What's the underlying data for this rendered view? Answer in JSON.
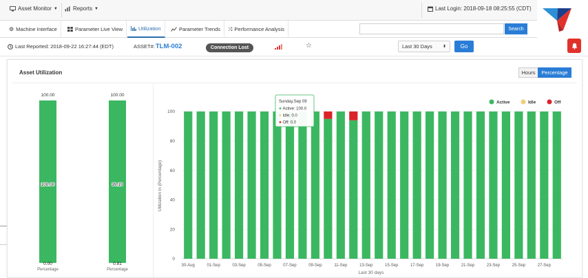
{
  "topbar": {
    "asset_monitor_label": "Asset Monitor",
    "reports_label": "Reports",
    "last_login": "Last Login: 2018-09-18 08:25:55 (CDT)"
  },
  "tabs": [
    {
      "label": "Machine Interface"
    },
    {
      "label": "Parameter Live View"
    },
    {
      "label": "Utilization"
    },
    {
      "label": "Parameter Trends"
    },
    {
      "label": "Performance Analysis"
    }
  ],
  "search": {
    "placeholder": "",
    "button_label": "Search"
  },
  "status": {
    "last_reported": "Last Reported: 2018-09-22 16:27:44 (EDT)",
    "asset_prefix": "ASSET#:",
    "asset_id": "TLM-002",
    "connection": "Connection Lost",
    "range_selected": "Last 30 Days",
    "go_label": "Go"
  },
  "panel": {
    "title": "Asset Utilization",
    "toggle_hours": "Hours",
    "toggle_percentage": "Percentage"
  },
  "colors": {
    "active": "#3cb761",
    "idle": "#f1cd7c",
    "off": "#d9242a",
    "accent": "#2a7dd6"
  },
  "summary_gauges": [
    {
      "top_value": "100.00",
      "center_value": "100.00",
      "bottom_value": "0.00",
      "axis_label": "Percentage",
      "value": 100
    },
    {
      "top_value": "100.00",
      "center_value": "99.19",
      "bottom_value": "0.81",
      "axis_label": "Percentage",
      "value": 100
    }
  ],
  "chart_data": {
    "type": "bar",
    "stacked": true,
    "xlabel": "Last 30 days",
    "ylabel": "Utilization in (Percentage)",
    "ylim": [
      0,
      100
    ],
    "yticks": [
      0,
      20,
      40,
      60,
      80,
      100
    ],
    "legend_position": "top-right",
    "x_tick_labels": [
      "30-Aug",
      "01-Sep",
      "03-Sep",
      "05-Sep",
      "07-Sep",
      "09-Sep",
      "11-Sep",
      "13-Sep",
      "15-Sep",
      "17-Sep",
      "19-Sep",
      "21-Sep",
      "23-Sep",
      "25-Sep",
      "27-Sep"
    ],
    "categories": [
      "30-Aug",
      "31-Aug",
      "01-Sep",
      "02-Sep",
      "03-Sep",
      "04-Sep",
      "05-Sep",
      "06-Sep",
      "07-Sep",
      "08-Sep",
      "09-Sep",
      "10-Sep",
      "11-Sep",
      "12-Sep",
      "13-Sep",
      "14-Sep",
      "15-Sep",
      "16-Sep",
      "17-Sep",
      "18-Sep",
      "19-Sep",
      "20-Sep",
      "21-Sep",
      "22-Sep",
      "23-Sep",
      "24-Sep",
      "25-Sep",
      "26-Sep",
      "27-Sep",
      "28-Sep"
    ],
    "series": [
      {
        "name": "Active",
        "values": [
          100,
          100,
          100,
          100,
          100,
          100,
          100,
          100,
          100,
          100,
          100,
          95,
          100,
          94,
          100,
          100,
          100,
          100,
          100,
          100,
          100,
          100,
          100,
          100,
          100,
          100,
          100,
          100,
          100,
          100
        ]
      },
      {
        "name": "Idle",
        "values": [
          0,
          0,
          0,
          0,
          0,
          0,
          0,
          0,
          0,
          0,
          0,
          0,
          0,
          0,
          0,
          0,
          0,
          0,
          0,
          0,
          0,
          0,
          0,
          0,
          0,
          0,
          0,
          0,
          0,
          0
        ]
      },
      {
        "name": "Off",
        "values": [
          0,
          0,
          0,
          0,
          0,
          0,
          0,
          0,
          0,
          0,
          0,
          5,
          0,
          6,
          0,
          0,
          0,
          0,
          0,
          0,
          0,
          0,
          0,
          0,
          0,
          0,
          0,
          0,
          0,
          0
        ]
      }
    ],
    "tooltip": {
      "title": "Sunday,Sep 09",
      "lines": [
        "Active: 100.0",
        "Idle: 0.0",
        "Off: 0.0"
      ]
    }
  }
}
